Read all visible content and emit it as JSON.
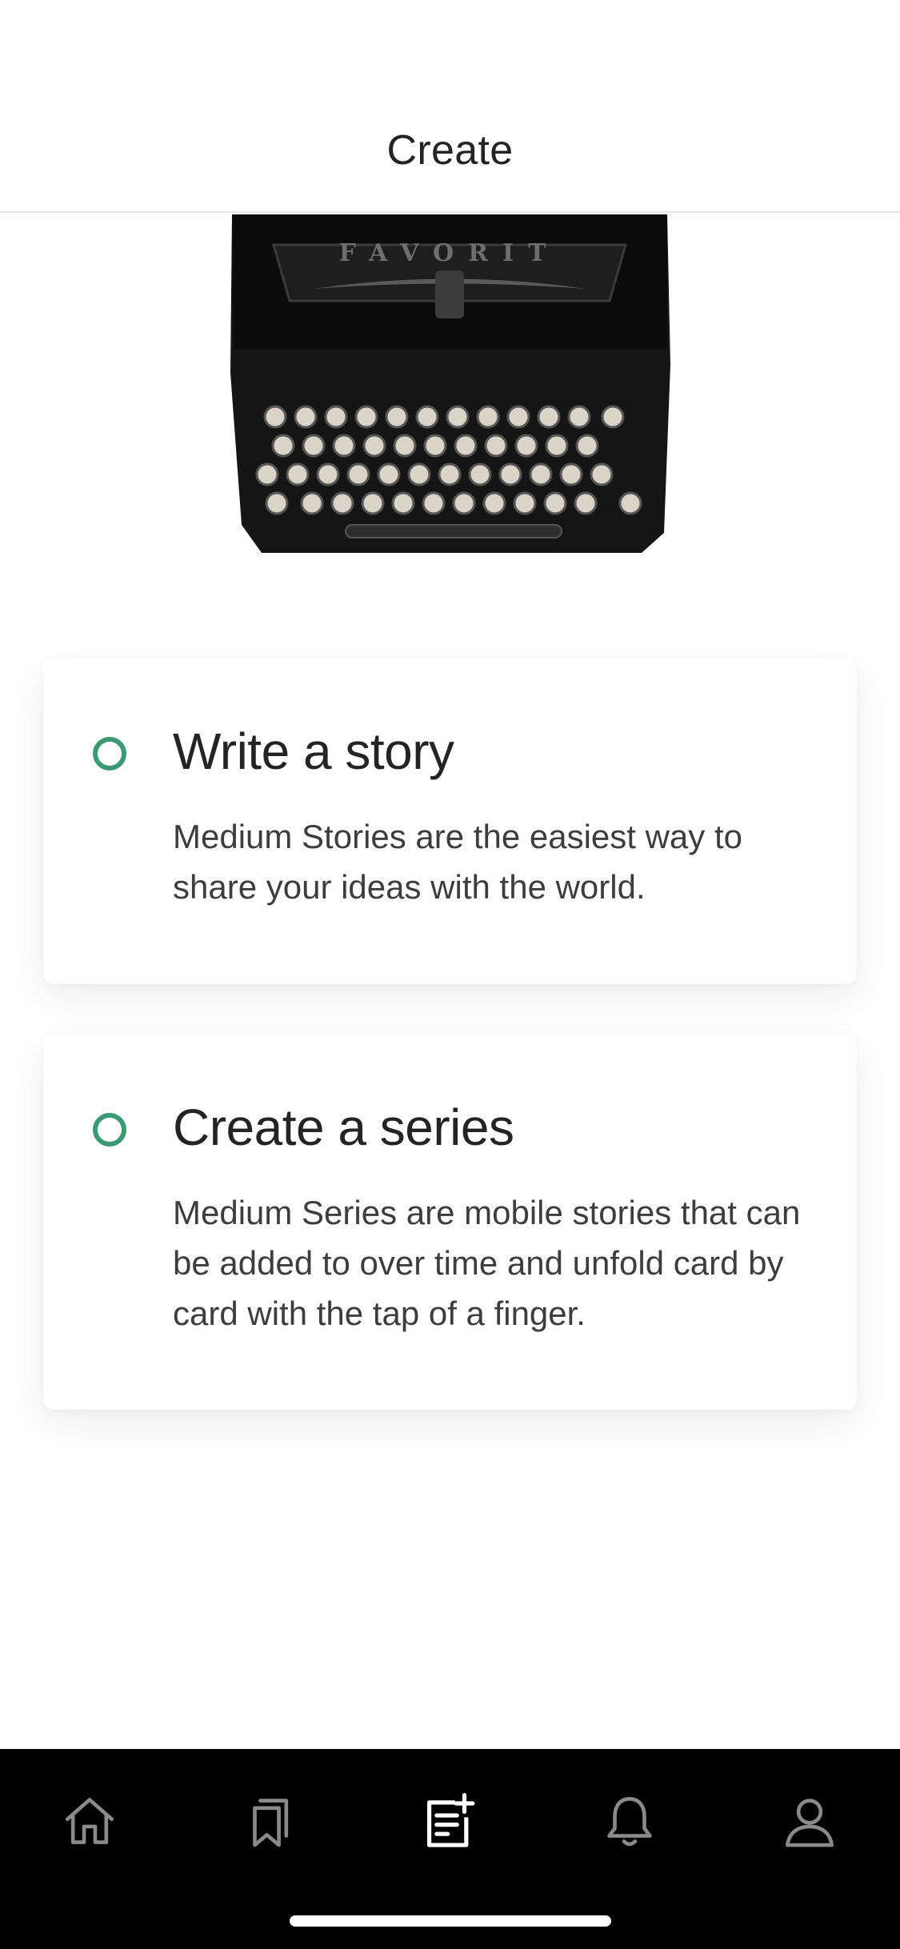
{
  "header": {
    "title": "Create"
  },
  "hero": {
    "brand_text": "FAVORIT",
    "image": "typewriter-illustration"
  },
  "options": [
    {
      "title": "Write a story",
      "description": "Medium Stories are the easiest way to share your ideas with the world."
    },
    {
      "title": "Create a series",
      "description": "Medium Series are mobile stories that can be added to over time and unfold card by card with the tap of a finger."
    }
  ],
  "tabbar": {
    "items": [
      {
        "icon": "home-icon",
        "active": false
      },
      {
        "icon": "bookmarks-icon",
        "active": false
      },
      {
        "icon": "create-icon",
        "active": true
      },
      {
        "icon": "bell-icon",
        "active": false
      },
      {
        "icon": "profile-icon",
        "active": false
      }
    ]
  },
  "colors": {
    "accent": "#3b9a72",
    "text": "#242424",
    "tabbar_bg": "#000000",
    "tab_active": "#ffffff",
    "tab_inactive": "#8a8a8a"
  }
}
